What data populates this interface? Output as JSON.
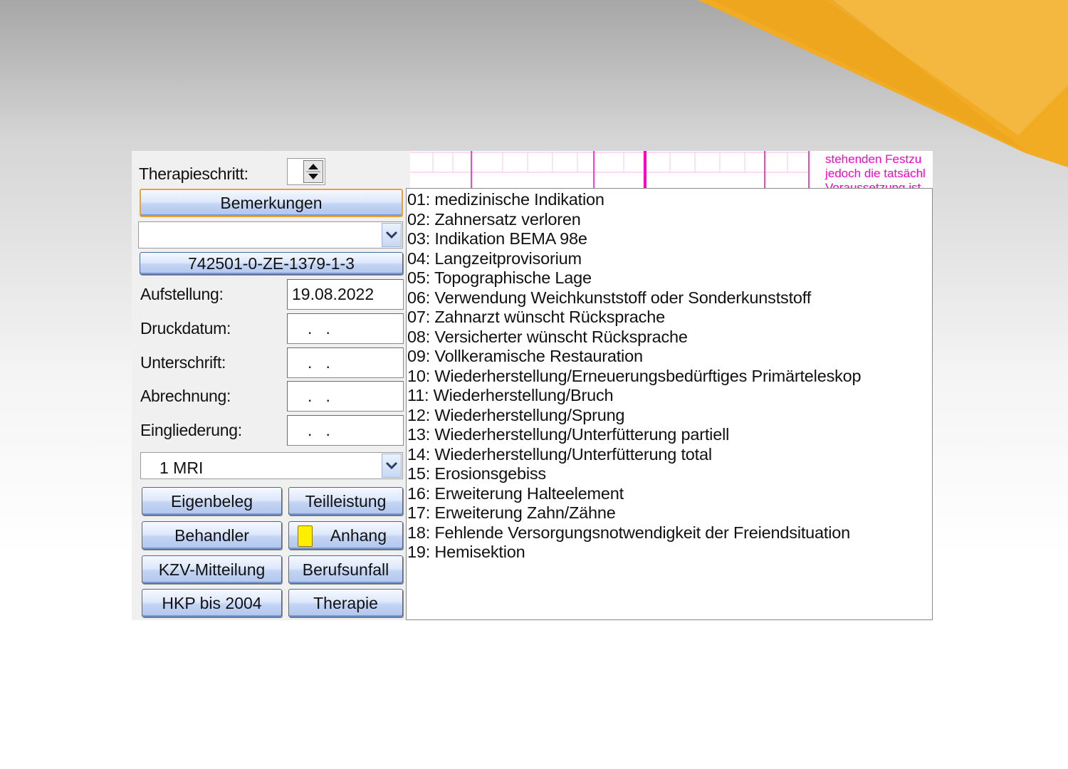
{
  "form": {
    "therapieschritt_label": "Therapieschritt:",
    "therapieschritt_value": "",
    "bemerkungen_label": "Bemerkungen",
    "combo_empty_value": "",
    "id_button_label": "742501-0-ZE-1379-1-3",
    "aufstellung_label": "Aufstellung:",
    "aufstellung_value": "19.08.2022",
    "druckdatum_label": "Druckdatum:",
    "druckdatum_value": ".   .",
    "unterschrift_label": "Unterschrift:",
    "unterschrift_value": ".   .",
    "abrechnung_label": "Abrechnung:",
    "abrechnung_value": ".   .",
    "eingliederung_label": "Eingliederung:",
    "eingliederung_value": ".   .",
    "mri_value": "1 MRI"
  },
  "buttons": {
    "eigenbeleg": "Eigenbeleg",
    "teilleistung": "Teilleistung",
    "behandler": "Behandler",
    "anhang": "Anhang",
    "kzv_mitteilung": "KZV-Mitteilung",
    "berufsunfall": "Berufsunfall",
    "hkp_bis_2004": "HKP bis 2004",
    "therapie": "Therapie"
  },
  "strip_text": {
    "line1": "stehenden Festzu",
    "line2": "jedoch die tatsächl",
    "line3": "Voraussetzung ist"
  },
  "list_items": [
    "01: medizinische Indikation",
    "02: Zahnersatz verloren",
    "03: Indikation BEMA 98e",
    "04: Langzeitprovisorium",
    "05: Topographische Lage",
    "06: Verwendung Weichkunststoff oder Sonderkunststoff",
    "07: Zahnarzt wünscht Rücksprache",
    "08: Versicherter wünscht Rücksprache",
    "09: Vollkeramische Restauration",
    "10: Wiederherstellung/Erneuerungsbedürftiges Primärteleskop",
    "11: Wiederherstellung/Bruch",
    "12: Wiederherstellung/Sprung",
    "13: Wiederherstellung/Unterfütterung partiell",
    "14: Wiederherstellung/Unterfütterung total",
    "15: Erosionsgebiss",
    "16: Erweiterung Halteelement",
    "17: Erweiterung Zahn/Zähne",
    "18: Fehlende Versorgungsnotwendigkeit der Freiendsituation",
    "19: Hemisektion"
  ],
  "colors": {
    "accent_orange": "#f2ac23",
    "pink": "#ff00c8",
    "button_blue": "#c3d4f3",
    "anhang_indicator": "#ffee00"
  },
  "icons": {
    "spinner": "up-down-arrows-icon",
    "dropdown": "chevron-down-icon",
    "attachment_indicator": "yellow-note-icon"
  }
}
